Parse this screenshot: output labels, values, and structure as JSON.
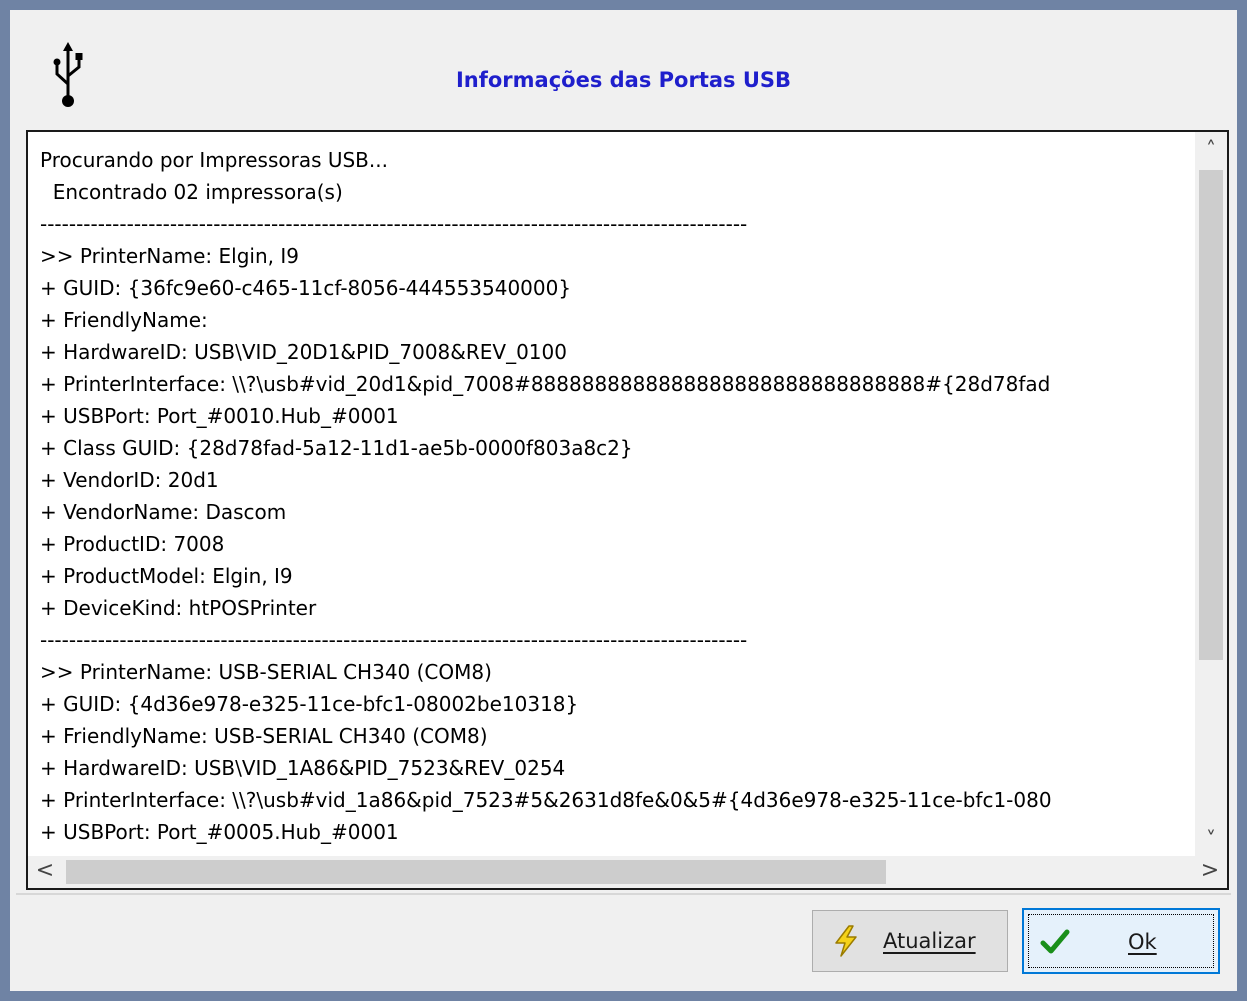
{
  "dialog": {
    "title": "Informações das Portas USB",
    "header_icon": "usb-icon"
  },
  "log": {
    "lines": [
      "Procurando por Impressoras USB...",
      "  Encontrado 02 impressora(s)",
      "--------------------------------------------------------------------------------------------------",
      ">> PrinterName: Elgin, I9",
      "+ GUID: {36fc9e60-c465-11cf-8056-444553540000}",
      "+ FriendlyName:",
      "+ HardwareID: USB\\VID_20D1&PID_7008&REV_0100",
      "+ PrinterInterface: \\\\?\\usb#vid_20d1&pid_7008#8888888888888888888888888888888#{28d78fad",
      "+ USBPort: Port_#0010.Hub_#0001",
      "+ Class GUID: {28d78fad-5a12-11d1-ae5b-0000f803a8c2}",
      "+ VendorID: 20d1",
      "+ VendorName: Dascom",
      "+ ProductID: 7008",
      "+ ProductModel: Elgin, I9",
      "+ DeviceKind: htPOSPrinter",
      "--------------------------------------------------------------------------------------------------",
      ">> PrinterName: USB-SERIAL CH340 (COM8)",
      "+ GUID: {4d36e978-e325-11ce-bfc1-08002be10318}",
      "+ FriendlyName: USB-SERIAL CH340 (COM8)",
      "+ HardwareID: USB\\VID_1A86&PID_7523&REV_0254",
      "+ PrinterInterface: \\\\?\\usb#vid_1a86&pid_7523#5&2631d8fe&0&5#{4d36e978-e325-11ce-bfc1-080",
      "+ USBPort: Port_#0005.Hub_#0001"
    ]
  },
  "scrollbars": {
    "up_icon": "chevron-up-icon",
    "down_icon": "chevron-down-icon",
    "left_icon": "chevron-left-icon",
    "right_icon": "chevron-right-icon",
    "up_glyph": "˄",
    "down_glyph": "˅",
    "left_glyph": "<",
    "right_glyph": ">"
  },
  "buttons": {
    "refresh_label": "Atualizar",
    "refresh_icon": "lightning-icon",
    "ok_label": "Ok",
    "ok_icon": "checkmark-icon"
  },
  "colors": {
    "title": "#1f1fcc",
    "window_frame": "#6f83a4",
    "focus_border": "#0078d7",
    "check_green": "#1a8f1a",
    "lightning_yellow": "#f5d218"
  }
}
